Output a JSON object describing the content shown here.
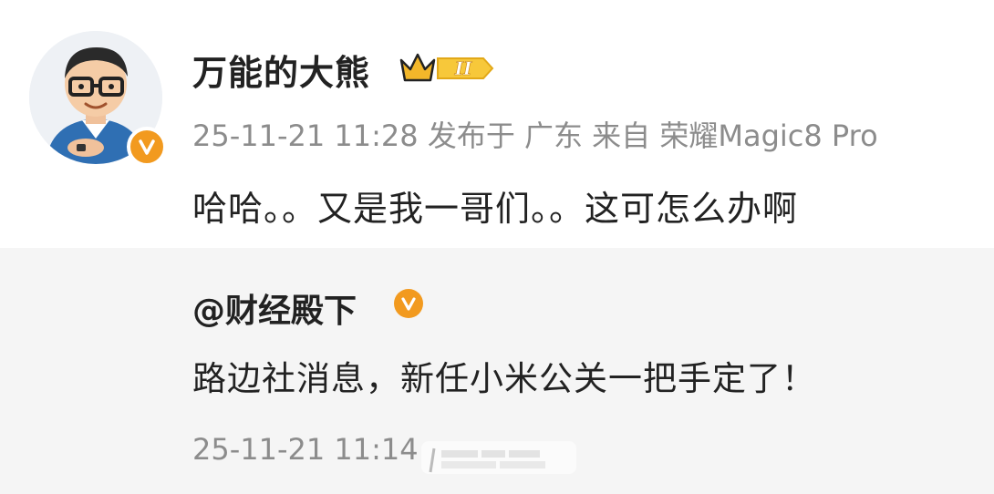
{
  "post": {
    "username": "万能的大熊",
    "level_badge": "II",
    "date": "25-11-21",
    "time": "11:28",
    "location": "发布于 广东",
    "source": "来自 荣耀Magic8 Pro",
    "content": "哈哈。。又是我一哥们。。这可怎么办啊"
  },
  "repost": {
    "username": "@财经殿下",
    "content": "路边社消息，新任小米公关一把手定了！",
    "timestamp": "25-11-21 11:14"
  },
  "colors": {
    "verified_badge": "#f29a1f",
    "meta_text": "#8c8c8c",
    "repost_bg": "#f5f5f5"
  },
  "icons": {
    "verified": "verified-v-icon",
    "level": "crown-level-icon"
  }
}
